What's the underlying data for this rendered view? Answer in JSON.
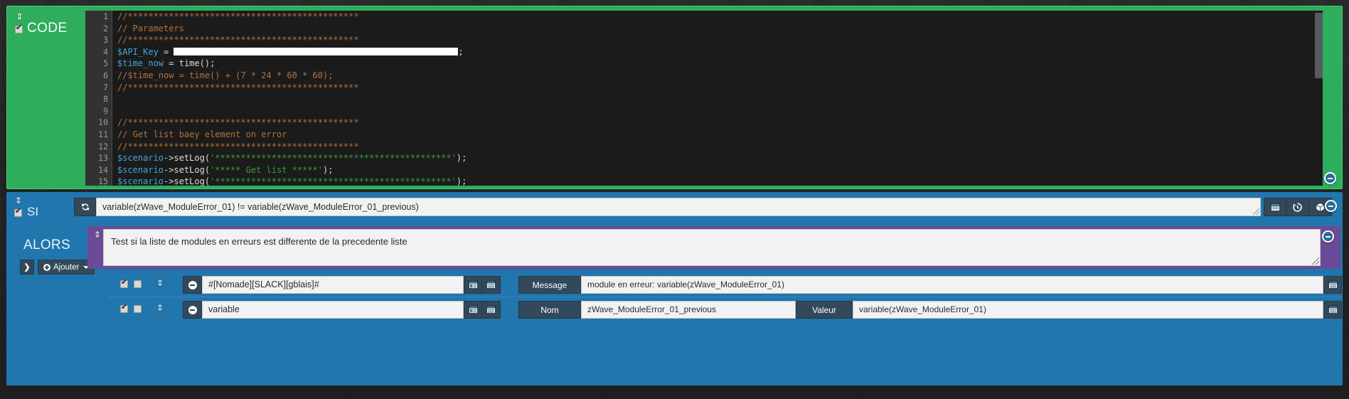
{
  "code_block": {
    "title": "CODE",
    "checkbox_checked": true,
    "drag_handle_icon": "vertical-resize-icon",
    "minus_icon": "minus-circle-icon",
    "lines": [
      {
        "n": "1",
        "segments": [
          {
            "t": "//*********************************************",
            "c": "cmt"
          }
        ]
      },
      {
        "n": "2",
        "segments": [
          {
            "t": "// Parameters",
            "c": "cmt"
          }
        ]
      },
      {
        "n": "3",
        "segments": [
          {
            "t": "//*********************************************",
            "c": "cmt"
          }
        ]
      },
      {
        "n": "4",
        "segments": [
          {
            "t": "$API_Key",
            "c": "var"
          },
          {
            "t": " = ",
            "c": "op"
          },
          {
            "t": "[REDACTED]",
            "c": "redact"
          },
          {
            "t": ";",
            "c": "op"
          }
        ]
      },
      {
        "n": "5",
        "segments": [
          {
            "t": "$time_now",
            "c": "var"
          },
          {
            "t": " = ",
            "c": "op"
          },
          {
            "t": "time",
            "c": "fn"
          },
          {
            "t": "();",
            "c": "op"
          }
        ]
      },
      {
        "n": "6",
        "segments": [
          {
            "t": "//$time_now = time() + (7 * 24 * 60 * 60);",
            "c": "cmt"
          }
        ]
      },
      {
        "n": "7",
        "segments": [
          {
            "t": "//*********************************************",
            "c": "cmt"
          }
        ]
      },
      {
        "n": "8",
        "segments": [
          {
            "t": "",
            "c": "op"
          }
        ]
      },
      {
        "n": "9",
        "segments": [
          {
            "t": "",
            "c": "op"
          }
        ]
      },
      {
        "n": "10",
        "segments": [
          {
            "t": "//*********************************************",
            "c": "cmt"
          }
        ]
      },
      {
        "n": "11",
        "segments": [
          {
            "t": "// Get list baey element on error",
            "c": "cmt"
          }
        ]
      },
      {
        "n": "12",
        "segments": [
          {
            "t": "//*********************************************",
            "c": "cmt"
          }
        ]
      },
      {
        "n": "13",
        "segments": [
          {
            "t": "$scenario",
            "c": "var"
          },
          {
            "t": "->setLog(",
            "c": "op"
          },
          {
            "t": "'**********************************************'",
            "c": "str"
          },
          {
            "t": ");",
            "c": "op"
          }
        ]
      },
      {
        "n": "14",
        "segments": [
          {
            "t": "$scenario",
            "c": "var"
          },
          {
            "t": "->setLog(",
            "c": "op"
          },
          {
            "t": "'***** Get list *****'",
            "c": "str"
          },
          {
            "t": ");",
            "c": "op"
          }
        ]
      },
      {
        "n": "15",
        "segments": [
          {
            "t": "$scenario",
            "c": "var"
          },
          {
            "t": "->setLog(",
            "c": "op"
          },
          {
            "t": "'**********************************************'",
            "c": "str"
          },
          {
            "t": ");",
            "c": "op"
          }
        ]
      }
    ]
  },
  "si_block": {
    "label": "SI",
    "checkbox_checked": true,
    "drag_handle_icon": "vertical-resize-icon",
    "refresh_icon": "refresh-icon",
    "condition_value": "variable(zWave_ModuleError_01) != variable(zWave_ModuleError_01_previous)",
    "condition_placeholder": "",
    "tools": [
      {
        "icon": "window-panel-icon",
        "name": "expression-editor-button"
      },
      {
        "icon": "history-icon",
        "name": "history-button"
      },
      {
        "icon": "box-3d-icon",
        "name": "object-browser-button"
      }
    ],
    "minus_icon": "minus-circle-icon"
  },
  "alors": {
    "label": "ALORS",
    "expand_label": "❯",
    "add_label": "Ajouter"
  },
  "comment_panel": {
    "text": "Test si la liste de modules en erreurs est differente de la precedente liste",
    "drag_handle_icon": "vertical-resize-icon",
    "minus_icon": "minus-circle-icon"
  },
  "actions": [
    {
      "enabled_checkbox": true,
      "second_checkbox": false,
      "drag_handle_icon": "vertical-resize-icon",
      "remove_icon": "minus-circle-icon",
      "command": "#[Nomade][SLACK][gblais]#",
      "icons": [
        {
          "icon": "list-options-icon",
          "name": "command-options-button"
        },
        {
          "icon": "window-panel-icon",
          "name": "command-expression-button"
        }
      ],
      "fields": [
        {
          "label": "Message",
          "value": "module en erreur: variable(zWave_ModuleError_01)"
        }
      ],
      "tail_icon": "window-panel-icon"
    },
    {
      "enabled_checkbox": true,
      "second_checkbox": false,
      "drag_handle_icon": "vertical-resize-icon",
      "remove_icon": "minus-circle-icon",
      "command": "variable",
      "icons": [
        {
          "icon": "list-options-icon",
          "name": "command-options-button"
        },
        {
          "icon": "window-panel-icon",
          "name": "command-expression-button"
        }
      ],
      "fields": [
        {
          "label": "Nom",
          "value": "zWave_ModuleError_01_previous"
        },
        {
          "label": "Valeur",
          "value": "variable(zWave_ModuleError_01)"
        }
      ],
      "tail_icon": "window-panel-icon"
    }
  ],
  "colors": {
    "code_green": "#2ead5c",
    "code_green_border": "#3fcf74",
    "si_blue": "#2176ae",
    "comment_purple": "#6b4a98",
    "button_dark": "#31495a",
    "editor_bg": "#1b1b1b",
    "comment_text": "#b5713a",
    "string_text": "#3a9d3a",
    "variable_text": "#44a6d6"
  }
}
